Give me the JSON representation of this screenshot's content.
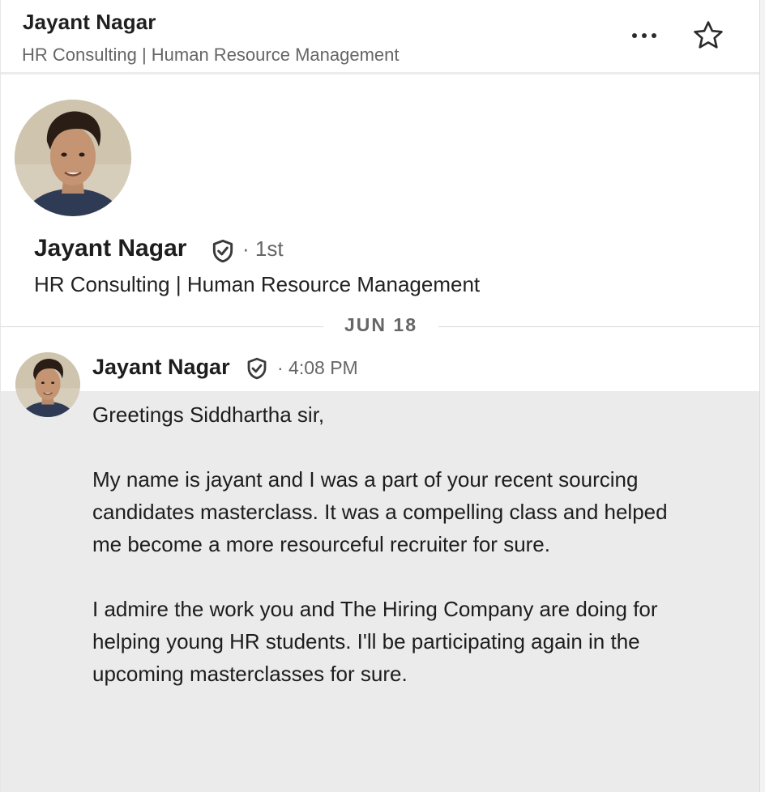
{
  "header": {
    "name": "Jayant Nagar",
    "headline": "HR Consulting | Human Resource Management",
    "more_icon": "more-horizontal-icon",
    "star_icon": "star-outline-icon"
  },
  "profile": {
    "name": "Jayant Nagar",
    "verified_icon": "verified-shield-icon",
    "degree": "· 1st",
    "headline": "HR Consulting | Human Resource Management"
  },
  "date_divider": "JUN 18",
  "message": {
    "sender": "Jayant Nagar",
    "verified_icon": "verified-shield-icon",
    "time": "· 4:08 PM",
    "greeting": "Greetings Siddhartha sir,",
    "paragraph1": "My name is jayant and I was a part of your recent sourcing candidates masterclass. It was a compelling class and helped me become a more resourceful recruiter for sure.",
    "paragraph2": "I admire the work you and The Hiring Company are doing for helping young HR students. I'll be participating again in the upcoming masterclasses for sure."
  },
  "colors": {
    "message_background": "#ebebeb",
    "muted_text": "#666666",
    "primary_text": "#1d1d1d"
  }
}
